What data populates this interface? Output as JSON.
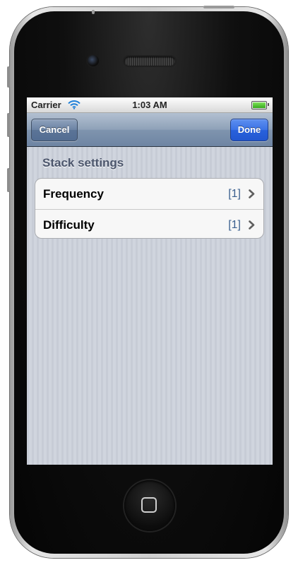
{
  "status_bar": {
    "carrier": "Carrier",
    "time": "1:03 AM",
    "wifi_icon": "wifi-icon",
    "battery_icon": "battery-full-icon"
  },
  "nav_bar": {
    "cancel_label": "Cancel",
    "done_label": "Done"
  },
  "section": {
    "header": "Stack settings",
    "rows": [
      {
        "label": "Frequency",
        "value": "[1]",
        "accessory_icon": "chevron-right-icon"
      },
      {
        "label": "Difficulty",
        "value": "[1]",
        "accessory_icon": "chevron-right-icon"
      }
    ]
  },
  "colors": {
    "nav_bar": "#7f94ae",
    "done_button": "#2861dc",
    "cell_value": "#3a5f8f",
    "section_header": "#4c566c",
    "background_stripe": "#c7ccd6"
  }
}
